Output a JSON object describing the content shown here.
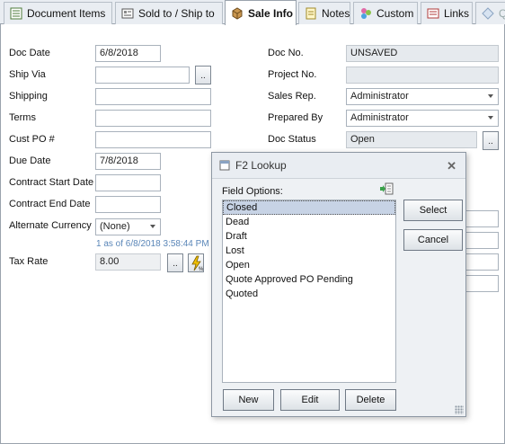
{
  "tabs": [
    {
      "label": "Document Items",
      "icon": "document-items-icon",
      "active": false
    },
    {
      "label": "Sold to / Ship to",
      "icon": "address-card-icon",
      "active": false
    },
    {
      "label": "Sale Info",
      "icon": "box-icon",
      "active": true
    },
    {
      "label": "Notes",
      "icon": "notes-icon",
      "active": false
    },
    {
      "label": "Custom",
      "icon": "custom-icon",
      "active": false
    },
    {
      "label": "Links",
      "icon": "links-icon",
      "active": false
    },
    {
      "label": "Q",
      "icon": "diamond-icon",
      "active": false
    }
  ],
  "left_form": {
    "doc_date": {
      "label": "Doc Date",
      "value": "6/8/2018"
    },
    "ship_via": {
      "label": "Ship Via",
      "value": "",
      "lookup": ".."
    },
    "shipping": {
      "label": "Shipping",
      "value": ""
    },
    "terms": {
      "label": "Terms",
      "value": ""
    },
    "cust_po": {
      "label": "Cust PO #",
      "value": ""
    },
    "due_date": {
      "label": "Due Date",
      "value": "7/8/2018"
    },
    "contract_start": {
      "label": "Contract Start Date",
      "value": ""
    },
    "contract_end": {
      "label": "Contract End Date",
      "value": ""
    },
    "alt_currency": {
      "label": "Alternate Currency",
      "value": "(None)"
    },
    "rate_hint": "1 as of 6/8/2018 3:58:44 PM",
    "tax_rate": {
      "label": "Tax Rate",
      "value": "8.00",
      "lookup": ".."
    }
  },
  "right_form": {
    "doc_no": {
      "label": "Doc No.",
      "value": "UNSAVED"
    },
    "project_no": {
      "label": "Project No.",
      "value": ""
    },
    "sales_rep": {
      "label": "Sales Rep.",
      "value": "Administrator"
    },
    "prepared_by": {
      "label": "Prepared By",
      "value": "Administrator"
    },
    "doc_status": {
      "label": "Doc Status",
      "value": "Open",
      "lookup": ".."
    }
  },
  "dialog": {
    "title": "F2 Lookup",
    "close": "✕",
    "field_options_label": "Field Options:",
    "options": [
      "Closed",
      "Dead",
      "Draft",
      "Lost",
      "Open",
      "Quote Approved PO Pending",
      "Quoted"
    ],
    "selected": "Closed",
    "buttons": {
      "select": "Select",
      "cancel": "Cancel",
      "new": "New",
      "edit": "Edit",
      "delete": "Delete"
    }
  },
  "colors": {
    "selection": "#c7d3e5",
    "hint": "#5a86b8",
    "tab_bg": "#e9edf2"
  }
}
